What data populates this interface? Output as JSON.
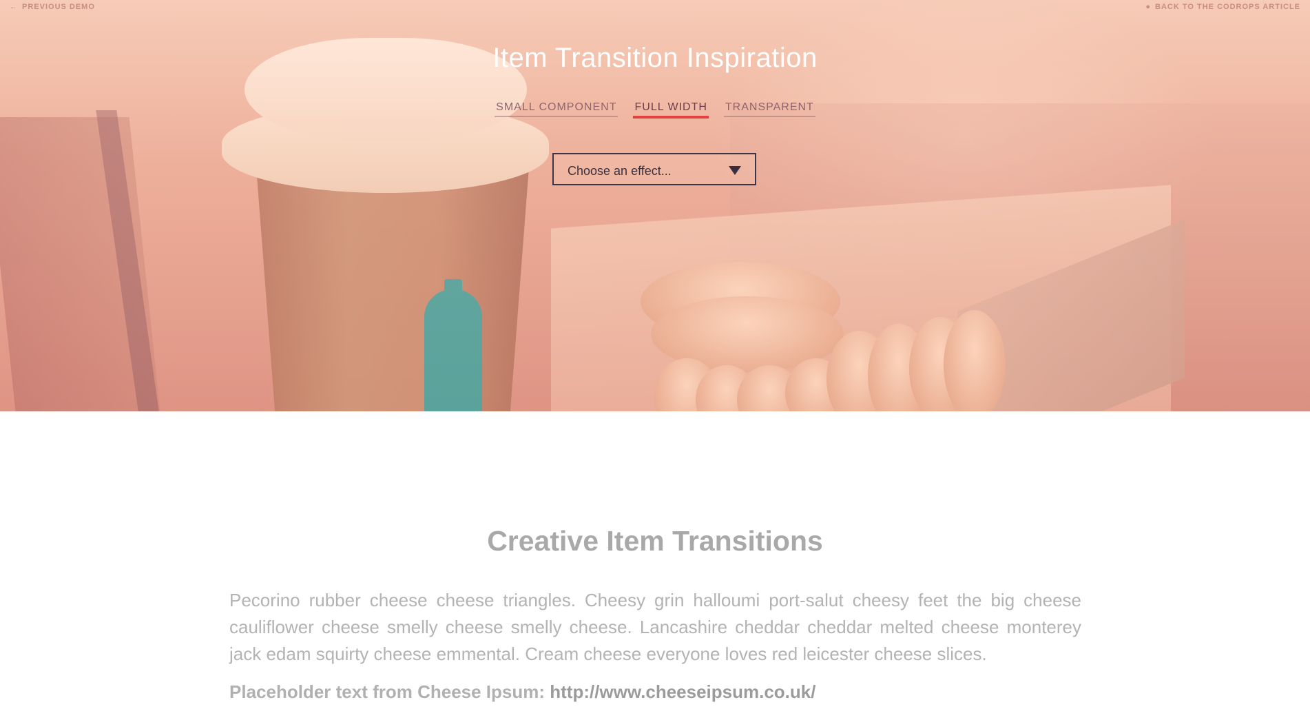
{
  "topbar": {
    "previous_label": "Previous Demo",
    "back_label": "Back to the Codrops Article"
  },
  "hero": {
    "title": "Item Transition Inspiration",
    "tabs": [
      {
        "label": "Small Component",
        "active": false
      },
      {
        "label": "Full Width",
        "active": true
      },
      {
        "label": "Transparent",
        "active": false
      }
    ],
    "select": {
      "value": "Choose an effect..."
    }
  },
  "content": {
    "title": "Creative Item Transitions",
    "body": "Pecorino rubber cheese cheese triangles. Cheesy grin halloumi port-salut cheesy feet the big cheese cauliflower cheese smelly cheese smelly cheese. Lancashire cheddar cheddar melted cheese monterey jack edam squirty cheese emmental. Cream cheese everyone loves red leicester cheese slices.",
    "source_label": "Placeholder text from Cheese Ipsum: ",
    "source_link": "http://www.cheeseipsum.co.uk/"
  },
  "colors": {
    "active_tab_underline": "#e24242",
    "tab_text": "#8f6470",
    "content_title": "#a9a9a9",
    "content_text": "#b3b3b3"
  },
  "icons": {
    "previous": "arrow-left-icon",
    "back": "drop-icon",
    "select": "triangle-down-icon"
  }
}
